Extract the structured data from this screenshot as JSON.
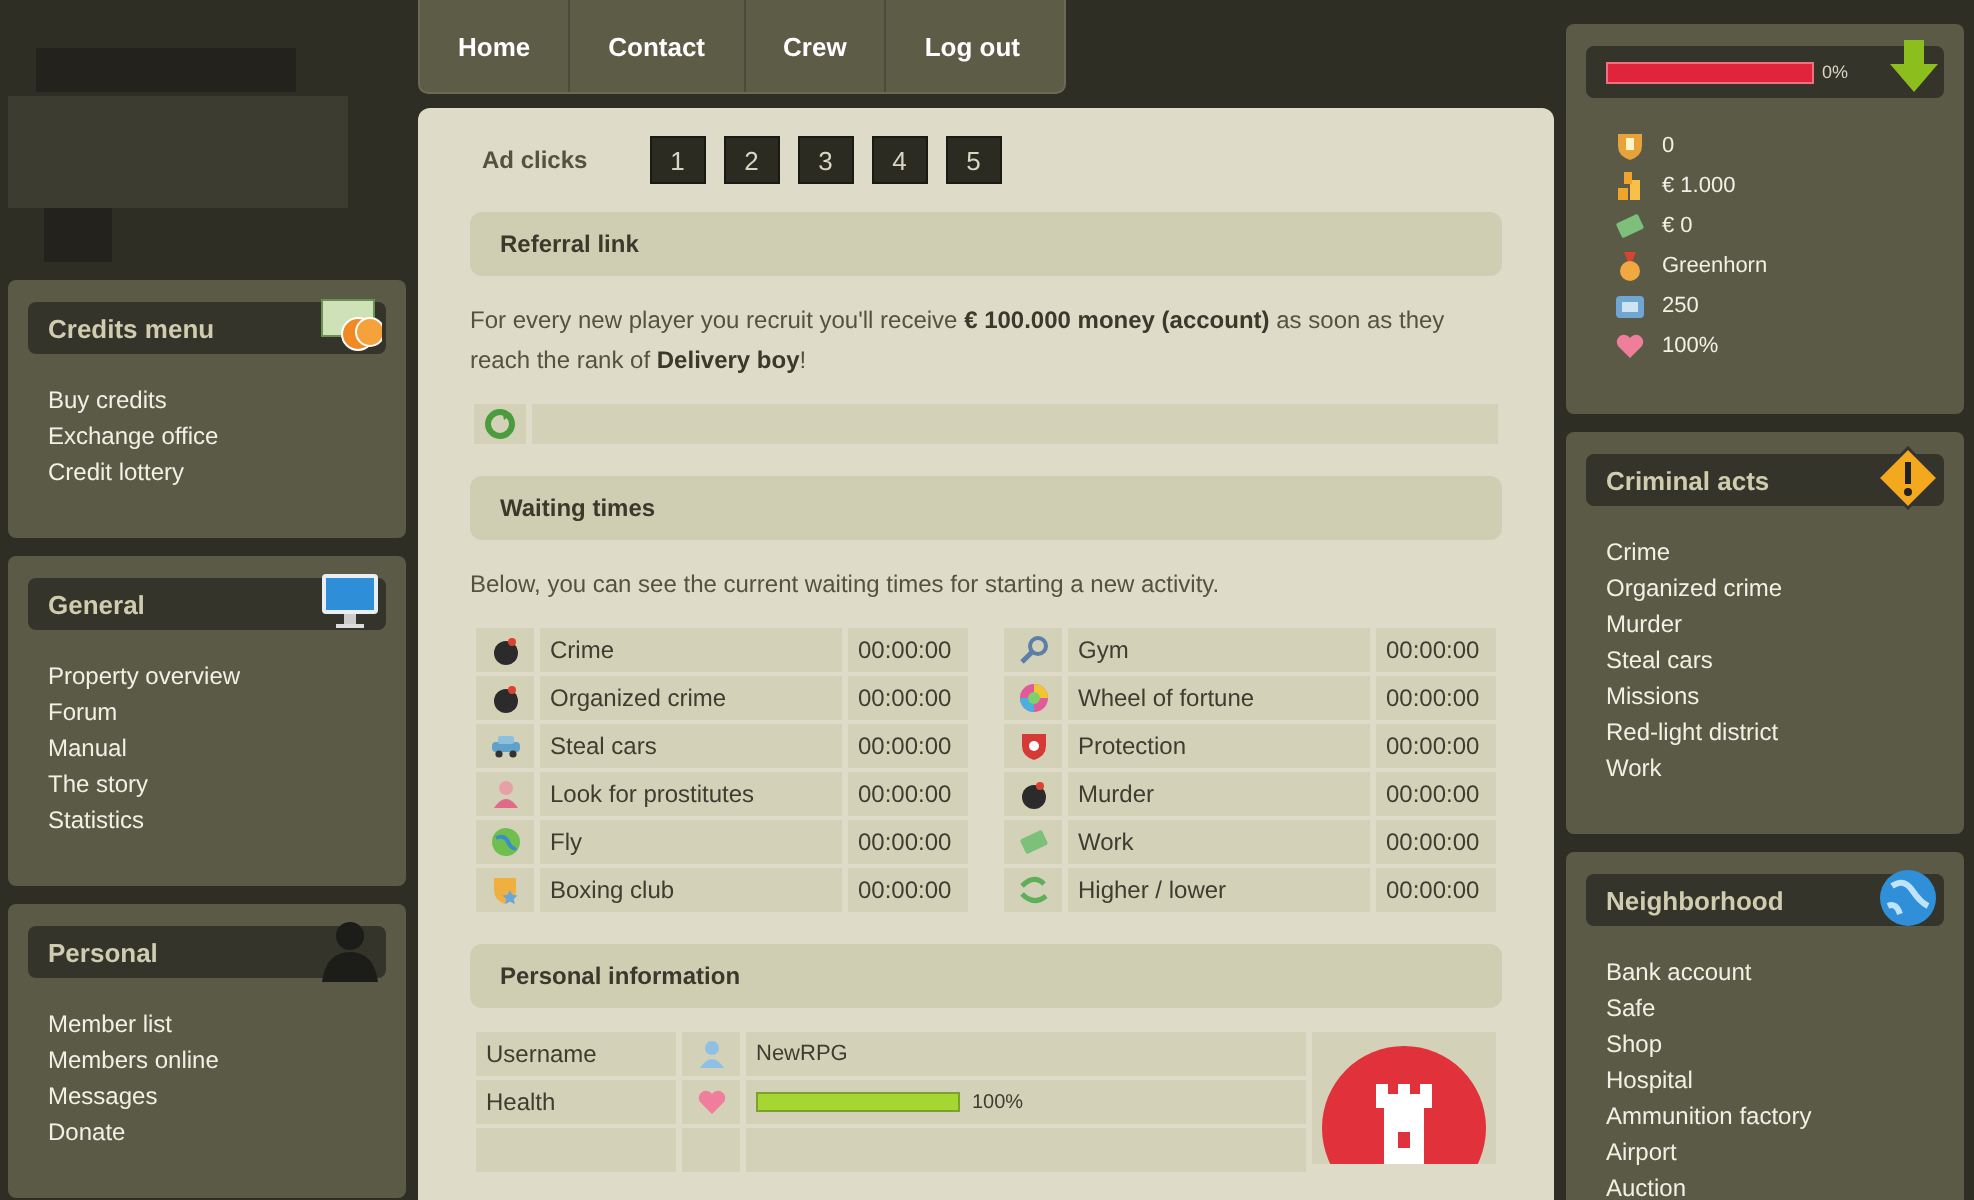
{
  "nav": [
    {
      "label": "Home"
    },
    {
      "label": "Contact"
    },
    {
      "label": "Crew"
    },
    {
      "label": "Log out"
    }
  ],
  "left_panels": [
    {
      "title": "Credits menu",
      "items": [
        "Buy credits",
        "Exchange office",
        "Credit lottery"
      ]
    },
    {
      "title": "General",
      "items": [
        "Property overview",
        "Forum",
        "Manual",
        "The story",
        "Statistics"
      ]
    },
    {
      "title": "Personal",
      "items": [
        "Member list",
        "Members online",
        "Messages",
        "Donate"
      ]
    }
  ],
  "ad_clicks": {
    "label": "Ad clicks",
    "buttons": [
      "1",
      "2",
      "3",
      "4",
      "5"
    ]
  },
  "referral": {
    "title": "Referral link",
    "text": "For every new player you recruit you'll receive **€ 100.000 money (account)** as soon as they reach the rank of **Delivery boy**!"
  },
  "waiting_times": {
    "title": "Waiting times",
    "intro": "Below, you can see the current waiting times for starting a new activity.",
    "left": [
      {
        "activity": "Crime",
        "time": "00:00:00"
      },
      {
        "activity": "Organized crime",
        "time": "00:00:00"
      },
      {
        "activity": "Steal cars",
        "time": "00:00:00"
      },
      {
        "activity": "Look for prostitutes",
        "time": "00:00:00"
      },
      {
        "activity": "Fly",
        "time": "00:00:00"
      },
      {
        "activity": "Boxing club",
        "time": "00:00:00"
      }
    ],
    "right": [
      {
        "activity": "Gym",
        "time": "00:00:00"
      },
      {
        "activity": "Wheel of fortune",
        "time": "00:00:00"
      },
      {
        "activity": "Protection",
        "time": "00:00:00"
      },
      {
        "activity": "Murder",
        "time": "00:00:00"
      },
      {
        "activity": "Work",
        "time": "00:00:00"
      },
      {
        "activity": "Higher / lower",
        "time": "00:00:00"
      }
    ]
  },
  "personal_information": {
    "title": "Personal information",
    "rows": [
      {
        "kind": "text",
        "label": "Username",
        "value": "NewRPG"
      },
      {
        "kind": "bar",
        "label": "Health",
        "level": 1,
        "reading": "100%"
      }
    ]
  },
  "status": {
    "experience": {
      "level": 0,
      "reading": "0%"
    },
    "stats": [
      "0",
      "€ 1.000",
      "€ 0",
      "Greenhorn",
      "250",
      "100%"
    ]
  },
  "right_panels": [
    {
      "title": "Criminal acts",
      "items": [
        "Crime",
        "Organized crime",
        "Murder",
        "Steal cars",
        "Missions",
        "Red-light district",
        "Work"
      ]
    },
    {
      "title": "Neighborhood",
      "items": [
        "Bank account",
        "Safe",
        "Shop",
        "Hospital",
        "Ammunition factory",
        "Airport",
        "Auction"
      ]
    }
  ]
}
